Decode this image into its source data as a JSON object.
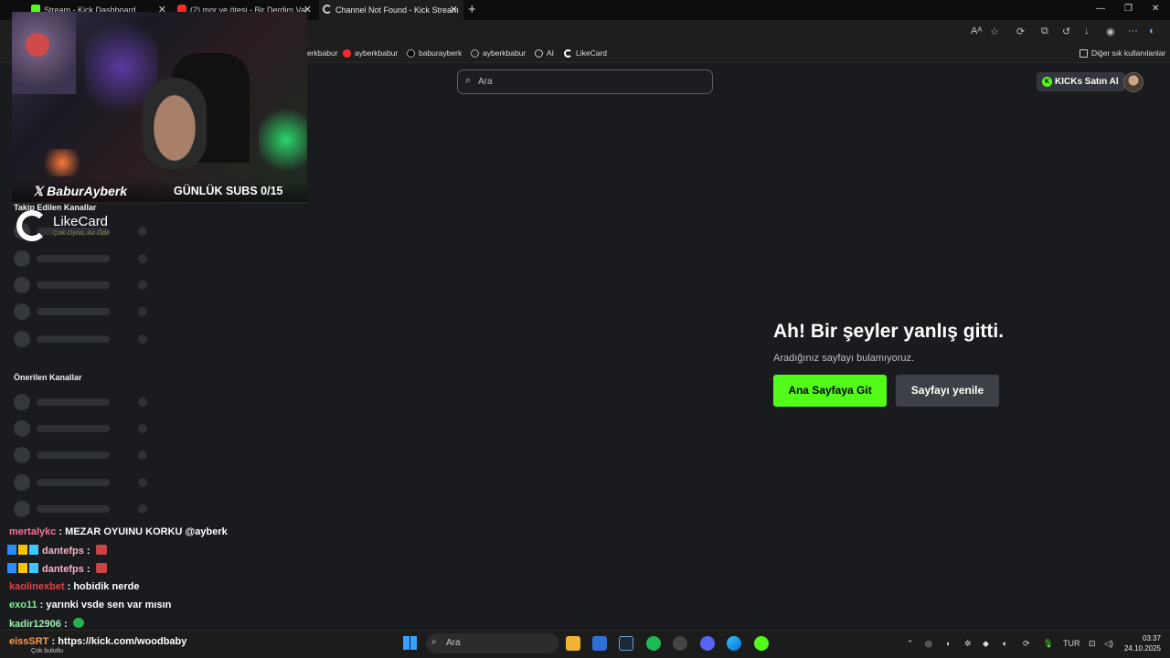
{
  "browser": {
    "tabs": [
      {
        "label": "Stream - Kick Dashboard"
      },
      {
        "label": "(2) mor ve ötesi - Bir Derdim Var"
      },
      {
        "label": "Channel Not Found - Kick Stream"
      }
    ],
    "bookmarks": [
      {
        "label": "erkbabur"
      },
      {
        "label": "ayberkbabur"
      },
      {
        "label": "baburayberk"
      },
      {
        "label": "ayberkbabur"
      },
      {
        "label": "AI"
      },
      {
        "label": "LikeCard"
      }
    ],
    "other_bookmarks": "Diğer sık kullanılanlar"
  },
  "header": {
    "search_placeholder": "Ara",
    "kicks_button": "KICKs Satın Al"
  },
  "sidebar": {
    "followed_title": "Takip Edilen Kanallar",
    "suggested_title": "Önerilen Kanallar"
  },
  "overlay": {
    "handle": "BaburAyberk",
    "subs": "GÜNLÜK SUBS 0/15",
    "sponsor_name": "LikeCard",
    "sponsor_tagline": "Çok Oyna, Az Öde"
  },
  "error": {
    "title": "Ah! Bir şeyler yanlış gitti.",
    "subtitle": "Aradığınız sayfayı bulamıyoruz.",
    "home_button": "Ana Sayfaya Git",
    "reload_button": "Sayfayı yenile"
  },
  "chat": [
    {
      "user": "mertalykc",
      "text": "MEZAR OYUINU KORKU @ayberk"
    },
    {
      "user": "dantefps",
      "text": ""
    },
    {
      "user": "dantefps",
      "text": ""
    },
    {
      "user": "kaolinexbet",
      "text": "hobidik nerde"
    },
    {
      "user": "exo11",
      "text": "yarınki vsde sen var mısın"
    },
    {
      "user": "kadir12906",
      "text": ""
    },
    {
      "user": "eissSRT",
      "text": "https://kick.com/woodbaby"
    }
  ],
  "taskbar": {
    "search_placeholder": "Ara",
    "status_left": "Çok bulutlu",
    "language": "TUR",
    "time": "03:37",
    "date": "24.10.2025"
  }
}
